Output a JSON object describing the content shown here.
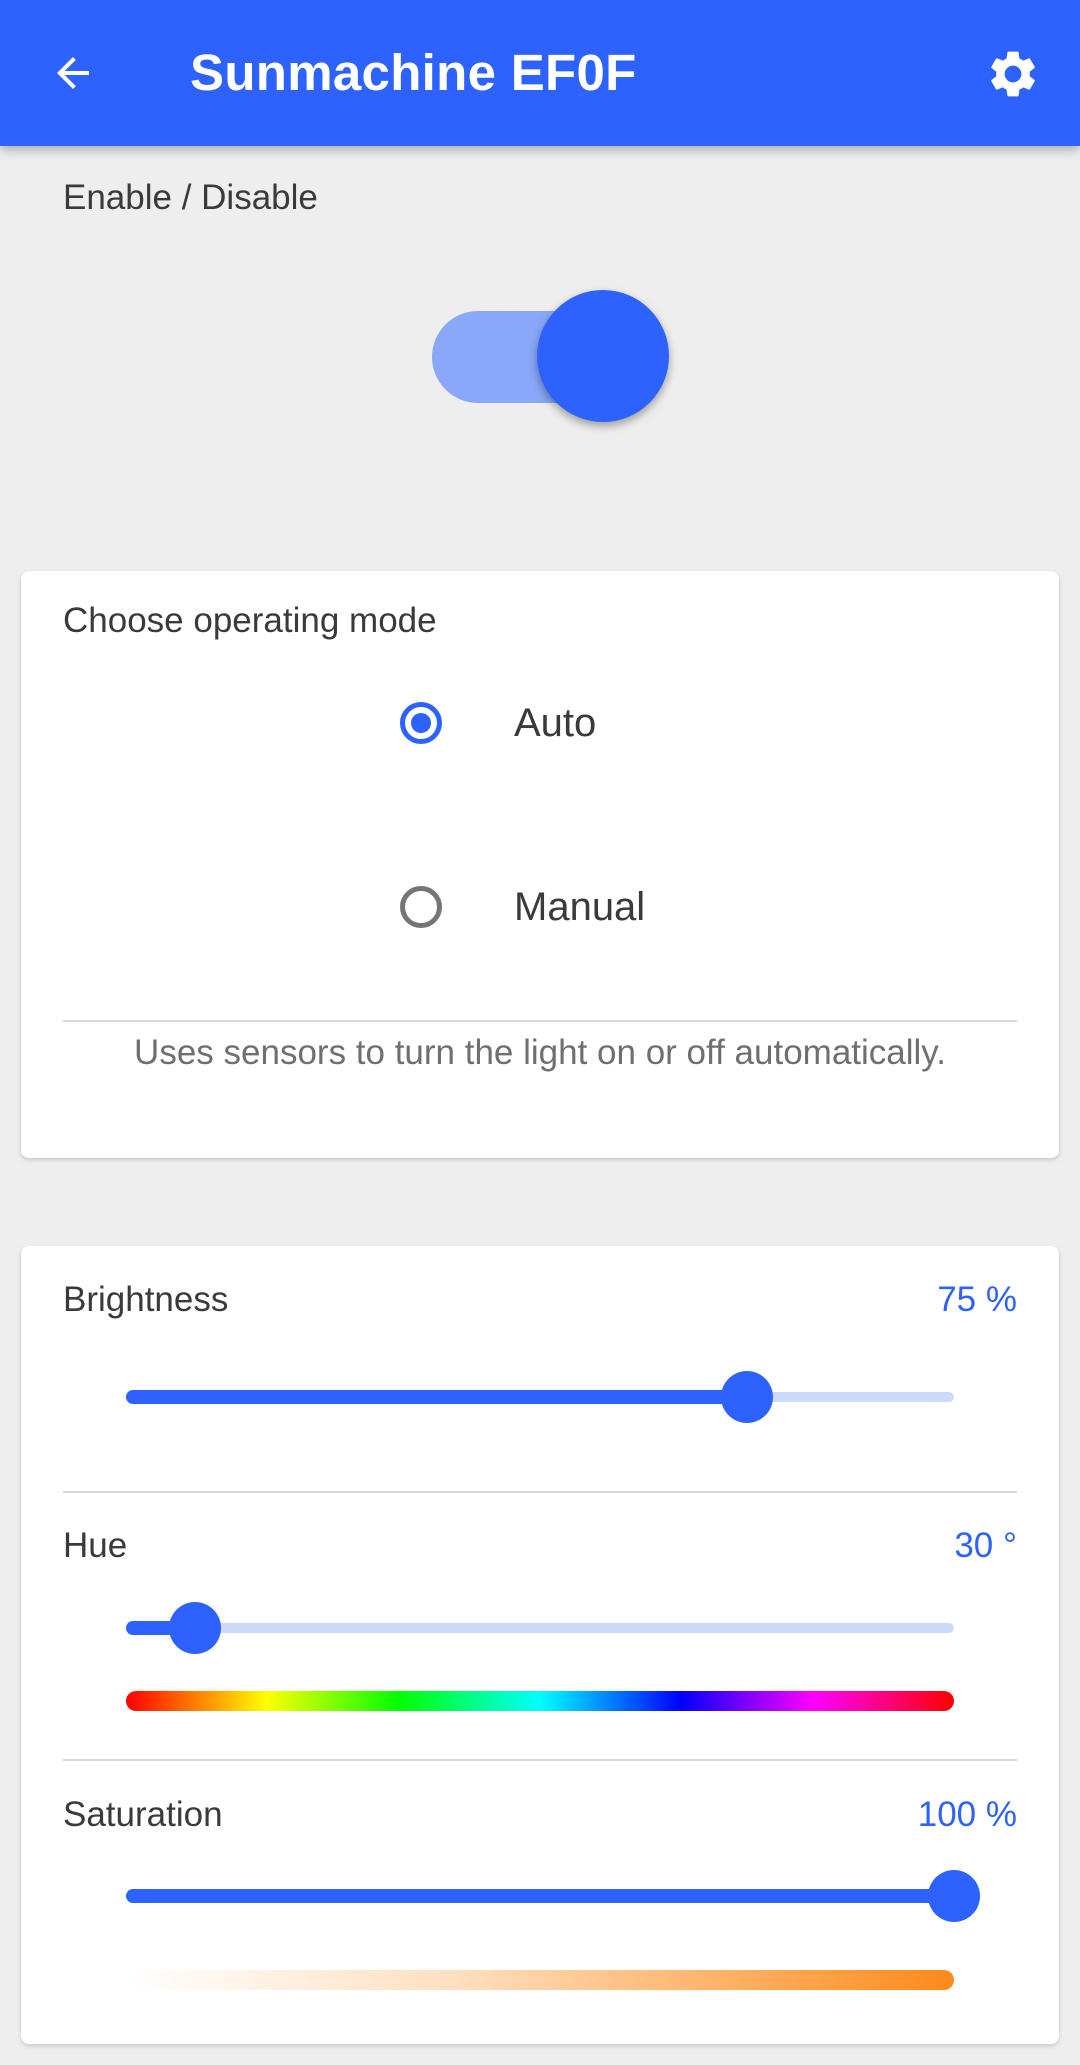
{
  "app_bar": {
    "title": "Sunmachine EF0F",
    "back_icon": "arrow-back-icon",
    "settings_icon": "gear-icon",
    "color": "#2d62ff"
  },
  "power": {
    "label": "Enable / Disable",
    "enabled": true
  },
  "mode": {
    "title": "Choose operating mode",
    "options": [
      {
        "label": "Auto",
        "selected": true
      },
      {
        "label": "Manual",
        "selected": false
      }
    ],
    "description": "Uses sensors to turn the light on or off automatically."
  },
  "light": {
    "brightness": {
      "label": "Brightness",
      "value_text": "75 %",
      "value": 75,
      "max": 100
    },
    "hue": {
      "label": "Hue",
      "value_text": "30 °",
      "value": 30,
      "max": 360
    },
    "saturation": {
      "label": "Saturation",
      "value_text": "100 %",
      "value": 100,
      "max": 100
    }
  }
}
